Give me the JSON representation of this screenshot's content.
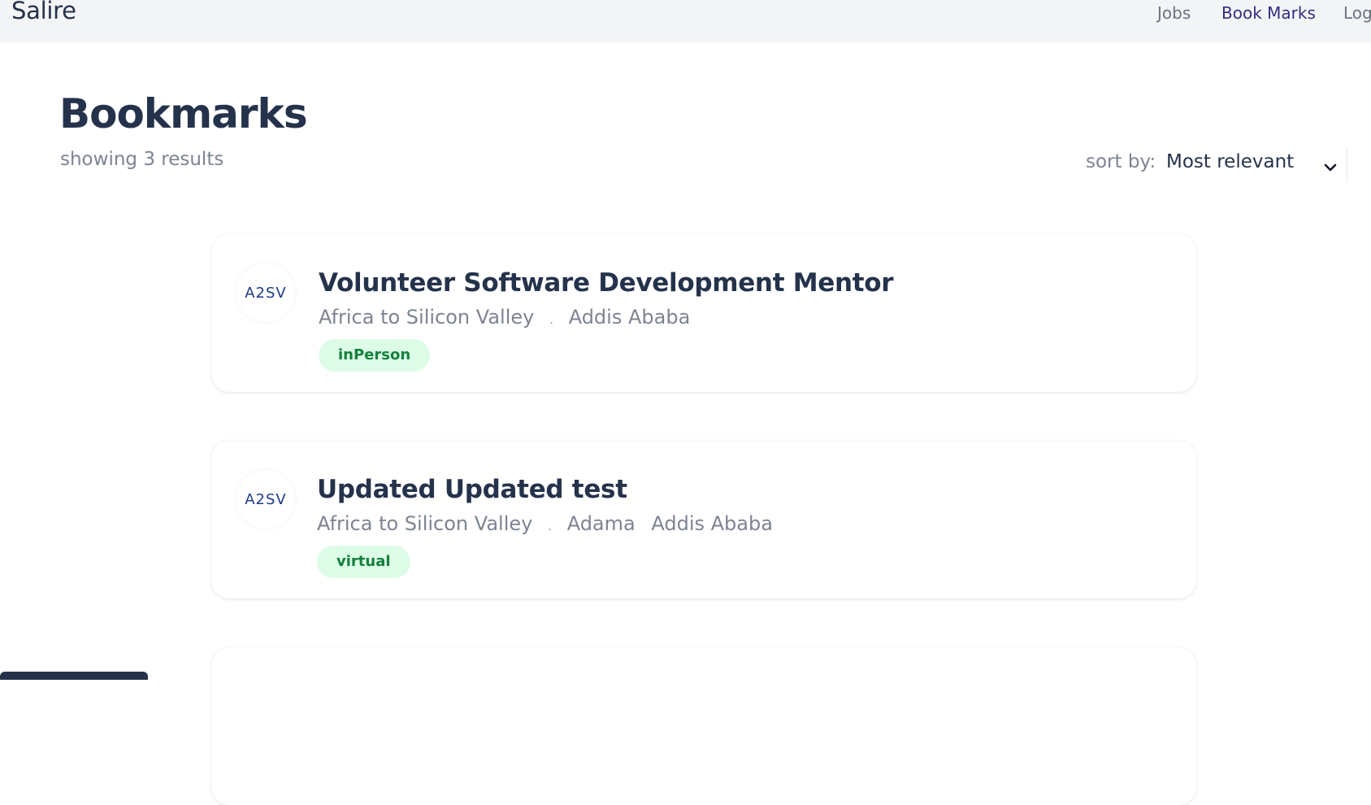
{
  "header": {
    "brand": "Salire",
    "nav": {
      "jobs": "Jobs",
      "bookmarks": "Book Marks",
      "login": "Log"
    }
  },
  "page": {
    "title": "Bookmarks",
    "result_count": "showing 3 results",
    "sort": {
      "label": "sort by:",
      "selected": "Most relevant"
    }
  },
  "bookmarks": [
    {
      "title": "Volunteer Software Development Mentor",
      "company": "Africa to Silicon Valley",
      "separator": ".",
      "locations": [
        "Addis Ababa"
      ],
      "tag": "inPerson",
      "logo_text": "A2SV"
    },
    {
      "title": "Updated Updated test",
      "company": "Africa to Silicon Valley",
      "separator": ".",
      "locations": [
        "Adama",
        "Addis Ababa"
      ],
      "tag": "virtual",
      "logo_text": "A2SV"
    }
  ],
  "colors": {
    "header_bg": "#f3f4f6",
    "text_primary": "#25324b",
    "text_muted": "#7c8493",
    "nav_active": "#312e81",
    "tag_bg": "#dcfce7",
    "tag_text": "#15803d"
  },
  "icons": {
    "sort": "chevron-down-icon",
    "company_logo": "company-logo-icon"
  }
}
